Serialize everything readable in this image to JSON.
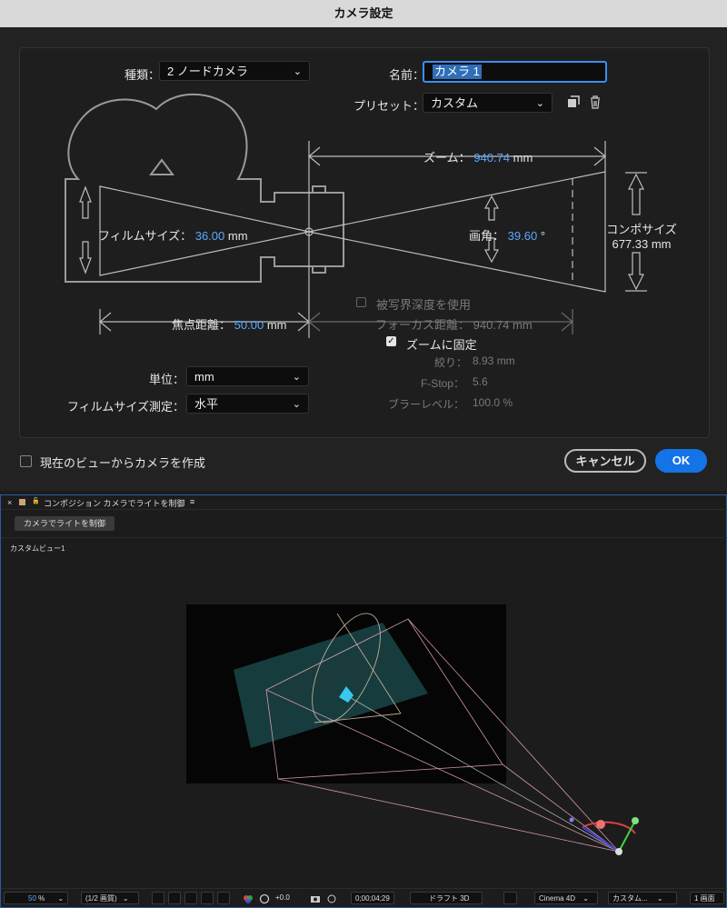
{
  "dialog": {
    "title": "カメラ設定",
    "type_label": "種類：",
    "type_value": "2 ノードカメラ",
    "name_label": "名前：",
    "name_value": "カメラ 1",
    "preset_label": "プリセット：",
    "preset_value": "カスタム",
    "zoom_label": "ズーム：",
    "zoom_value": "940.74",
    "zoom_unit": "mm",
    "film_label": "フィルムサイズ：",
    "film_value": "36.00",
    "film_unit": "mm",
    "angle_label": "画角：",
    "angle_value": "39.60",
    "angle_unit": "°",
    "comp_size_label": "コンポサイズ",
    "comp_size_value": "677.33 mm",
    "focal_label": "焦点距離：",
    "focal_value": "50.00",
    "focal_unit": "mm",
    "dof_label": "被写界深度を使用",
    "dof_checked": false,
    "focus_dist_label": "フォーカス距離：",
    "focus_dist_value": "940.74 mm",
    "lock_zoom_label": "ズームに固定",
    "lock_zoom_checked": true,
    "aperture_label": "絞り：",
    "aperture_value": "8.93 mm",
    "fstop_label": "F-Stop：",
    "fstop_value": "5.6",
    "blur_label": "ブラーレベル：",
    "blur_value": "100.0 %",
    "units_label": "単位：",
    "units_value": "mm",
    "measure_label": "フィルムサイズ測定：",
    "measure_value": "水平",
    "create_from_view_label": "現在のビューからカメラを作成",
    "cancel_label": "キャンセル",
    "ok_label": "OK",
    "chevron": "⌄"
  },
  "comp": {
    "close_glyph": "×",
    "lock_glyph": "🔓",
    "tab_title": "コンポジション カメラでライトを制御",
    "menu_glyph": "≡",
    "breadcrumb": "カメラでライトを制御",
    "view_label": "カスタムビュー1",
    "zoom_value": "50",
    "zoom_unit": "%",
    "resolution": "(1/2 画質)",
    "exposure": "+0.0",
    "timecode": "0;00;04;29",
    "renderer_label": "ドラフト 3D",
    "engine": "Cinema 4D",
    "view_select": "カスタム...",
    "layout_select": "1 画面"
  },
  "colors": {
    "accent": "#1473e6",
    "value_blue": "#5aa8ff",
    "teal": "#1f5a5a"
  }
}
